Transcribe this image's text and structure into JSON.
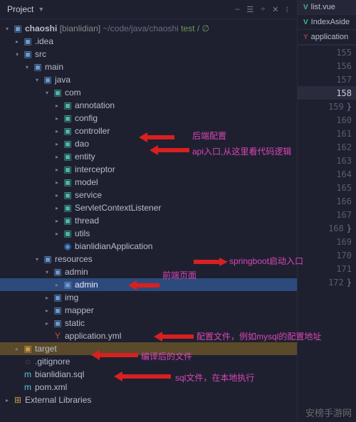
{
  "panel": {
    "title": "Project",
    "icons": [
      "–",
      "☰",
      "÷",
      "✕",
      "⁝"
    ]
  },
  "root": {
    "name": "chaoshi",
    "bracket": "[bianlidian]",
    "path": "~/code/java/chaoshi",
    "flags": "test / ∅"
  },
  "tree": [
    {
      "d": 1,
      "a": ">",
      "i": "folder-blue",
      "t": ".idea"
    },
    {
      "d": 1,
      "a": "v",
      "i": "folder-blue",
      "t": "src"
    },
    {
      "d": 2,
      "a": "v",
      "i": "folder-blue",
      "t": "main"
    },
    {
      "d": 3,
      "a": "v",
      "i": "folder-blue",
      "t": "java"
    },
    {
      "d": 4,
      "a": "v",
      "i": "folder-teal",
      "t": "com"
    },
    {
      "d": 5,
      "a": ">",
      "i": "folder-teal",
      "t": "annotation"
    },
    {
      "d": 5,
      "a": ">",
      "i": "folder-teal",
      "t": "config"
    },
    {
      "d": 5,
      "a": ">",
      "i": "folder-teal",
      "t": "controller"
    },
    {
      "d": 5,
      "a": ">",
      "i": "folder-teal",
      "t": "dao"
    },
    {
      "d": 5,
      "a": ">",
      "i": "folder-teal",
      "t": "entity"
    },
    {
      "d": 5,
      "a": ">",
      "i": "folder-teal",
      "t": "interceptor"
    },
    {
      "d": 5,
      "a": ">",
      "i": "folder-teal",
      "t": "model"
    },
    {
      "d": 5,
      "a": ">",
      "i": "folder-teal",
      "t": "service"
    },
    {
      "d": 5,
      "a": ">",
      "i": "folder-teal",
      "t": "ServletContextListener"
    },
    {
      "d": 5,
      "a": ">",
      "i": "folder-teal",
      "t": "thread"
    },
    {
      "d": 5,
      "a": ">",
      "i": "folder-teal",
      "t": "utils"
    },
    {
      "d": 5,
      "a": "",
      "i": "file-kt",
      "t": "bianlidianApplication"
    },
    {
      "d": 3,
      "a": "v",
      "i": "folder-blue",
      "t": "resources"
    },
    {
      "d": 4,
      "a": "v",
      "i": "folder-blue",
      "t": "admin"
    },
    {
      "d": 5,
      "a": ">",
      "i": "folder-blue",
      "t": "admin",
      "sel": true
    },
    {
      "d": 4,
      "a": ">",
      "i": "folder-blue",
      "t": "img"
    },
    {
      "d": 4,
      "a": ">",
      "i": "folder-blue",
      "t": "mapper"
    },
    {
      "d": 4,
      "a": ">",
      "i": "folder-blue",
      "t": "static"
    },
    {
      "d": 4,
      "a": "",
      "i": "file-yml",
      "t": "application.yml"
    },
    {
      "d": 1,
      "a": ">",
      "i": "folder-orange",
      "t": "target",
      "hl": true
    },
    {
      "d": 1,
      "a": "",
      "i": "file-gray",
      "t": ".gitignore"
    },
    {
      "d": 1,
      "a": "",
      "i": "file-cyan",
      "t": "bianlidian.sql"
    },
    {
      "d": 1,
      "a": "",
      "i": "file-cyan",
      "t": "pom.xml"
    }
  ],
  "extLib": "External Libraries",
  "annotations": {
    "config": "后端配置",
    "controller": "api入口,从这里看代码逻辑",
    "app": "springboot启动入口",
    "admin": "前端页面",
    "yml": "配置文件，例如mysql的配置地址",
    "target": "编译后的文件",
    "sql": "sql文件，在本地执行"
  },
  "tabs": [
    {
      "icon": "V",
      "cls": "vue-icon",
      "label": "list.vue",
      "active": true
    },
    {
      "icon": "V",
      "cls": "vue-icon",
      "label": "IndexAside"
    },
    {
      "icon": "Y",
      "cls": "yml-icon",
      "label": "application"
    }
  ],
  "gutter": {
    "start": 155,
    "count": 18,
    "current": 158,
    "braces": {
      "159": "}",
      "168": "}",
      "172": "}"
    }
  },
  "watermark": "安榜手游网"
}
